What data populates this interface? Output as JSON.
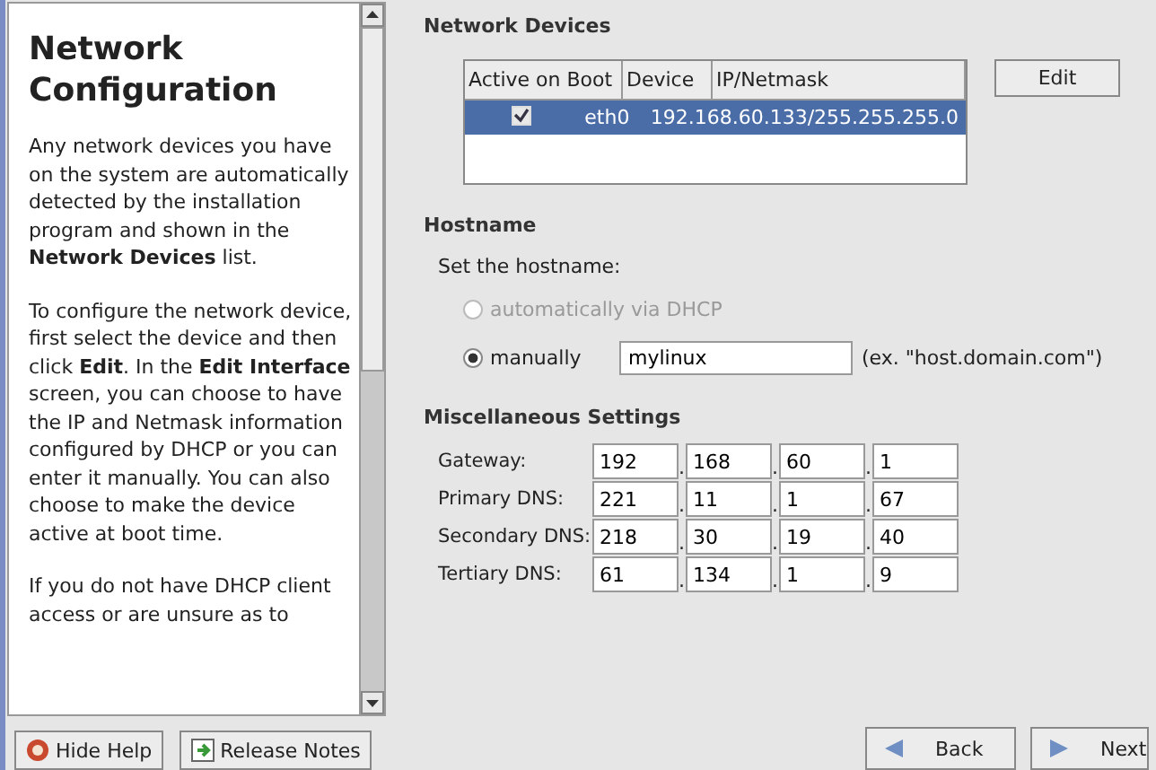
{
  "help": {
    "title": "Network Configuration",
    "paragraphs": [
      "Any network devices you have on the system are automatically detected by the installation program and shown in the **Network Devices** list.",
      "To configure the network device, first select the device and then click **Edit**. In the **Edit Interface** screen, you can choose to have the IP and Netmask information configured by DHCP or you can enter it manually. You can also choose to make the device active at boot time.",
      "If you do not have DHCP client access or are unsure as to"
    ]
  },
  "network_devices": {
    "heading": "Network Devices",
    "columns": [
      "Active on Boot",
      "Device",
      "IP/Netmask"
    ],
    "rows": [
      {
        "active_on_boot": true,
        "device": "eth0",
        "ip_netmask": "192.168.60.133/255.255.255.0",
        "selected": true
      }
    ],
    "edit_button": "Edit"
  },
  "hostname": {
    "heading": "Hostname",
    "prompt": "Set the hostname:",
    "options": [
      {
        "label": "automatically via DHCP",
        "selected": false,
        "disabled": true
      },
      {
        "label": "manually",
        "selected": true,
        "disabled": false,
        "value": "mylinux",
        "hint": "(ex. \"host.domain.com\")"
      }
    ]
  },
  "misc": {
    "heading": "Miscellaneous Settings",
    "separator": ".",
    "rows": [
      {
        "label": "Gateway:",
        "octets": [
          "192",
          "168",
          "60",
          "1"
        ]
      },
      {
        "label": "Primary DNS:",
        "octets": [
          "221",
          "11",
          "1",
          "67"
        ]
      },
      {
        "label": "Secondary DNS:",
        "octets": [
          "218",
          "30",
          "19",
          "40"
        ]
      },
      {
        "label": "Tertiary DNS:",
        "octets": [
          "61",
          "134",
          "1",
          "9"
        ]
      }
    ]
  },
  "buttons": {
    "hide_help": "Hide Help",
    "release_notes": "Release Notes",
    "back": "Back",
    "next": "Next"
  }
}
